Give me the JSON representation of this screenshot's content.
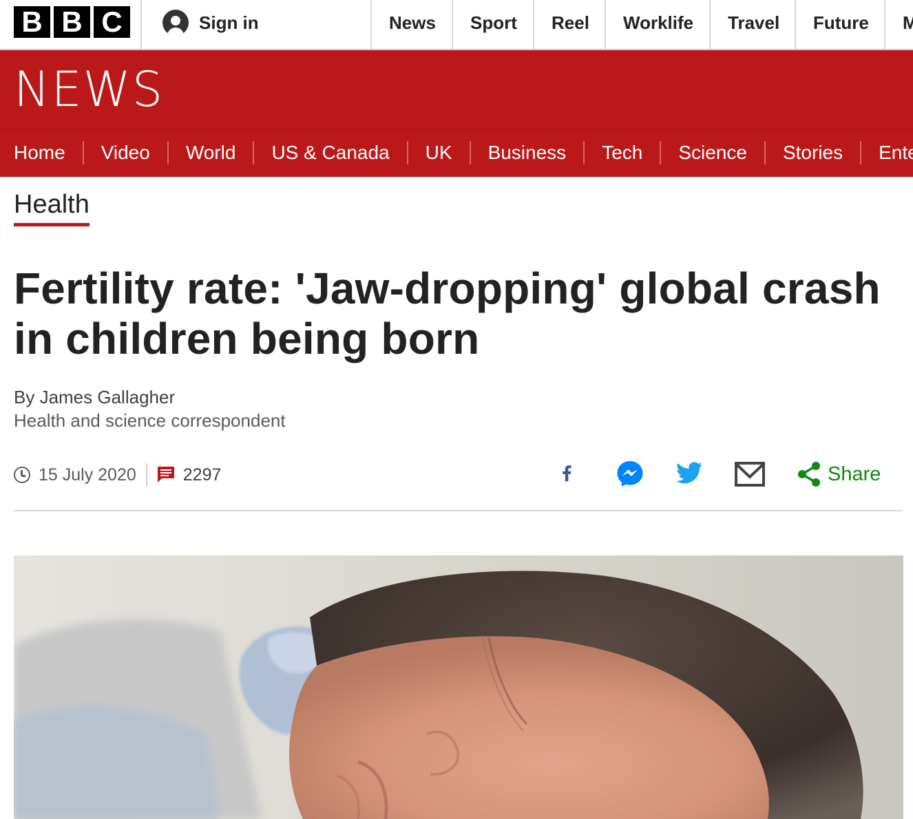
{
  "topbar": {
    "logo_letters": [
      "B",
      "B",
      "C"
    ],
    "signin_label": "Sign in",
    "nav": [
      "News",
      "Sport",
      "Reel",
      "Worklife",
      "Travel",
      "Future",
      "M"
    ]
  },
  "banner": {
    "wordmark": "NEWS",
    "color": "#bb1919"
  },
  "section_nav": [
    "Home",
    "Video",
    "World",
    "US & Canada",
    "UK",
    "Business",
    "Tech",
    "Science",
    "Stories",
    "Ente"
  ],
  "section_label": "Health",
  "headline": "Fertility rate: 'Jaw-dropping' global crash in children being born",
  "byline": {
    "author": "By James Gallagher",
    "role": "Health and science correspondent"
  },
  "meta": {
    "date": "15 July 2020",
    "comment_count": "2297"
  },
  "share": {
    "icons": [
      "facebook-icon",
      "messenger-icon",
      "twitter-icon",
      "email-icon",
      "share-icon"
    ],
    "label": "Share"
  },
  "colors": {
    "brand_red": "#bb1919",
    "facebook": "#3b5998",
    "messenger": "#0084ff",
    "twitter": "#1da1f2",
    "share_green": "#118811"
  }
}
